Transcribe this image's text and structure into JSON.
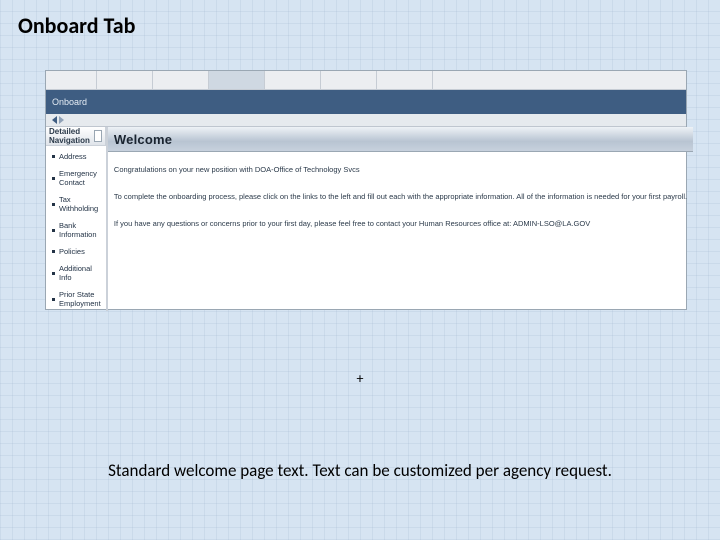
{
  "slide": {
    "title": "Onboard Tab",
    "plus": "+",
    "caption": "Standard welcome page text. Text can be customized per agency request."
  },
  "app": {
    "section": "Onboard"
  },
  "sidebar": {
    "header": "Detailed Navigation",
    "items": [
      "Address",
      "Emergency Contact",
      "Tax Withholding",
      "Bank Information",
      "Policies",
      "Additional Info",
      "Prior State Employment"
    ]
  },
  "main": {
    "heading": "Welcome",
    "lines": [
      "Congratulations on your new position with DOA-Office of Technology Svcs",
      "To complete the onboarding process, please click on the links to the left and fill out each with the appropriate information. All of the information is needed for your first payroll.",
      "If you have any questions or concerns prior to your first day, please feel free to contact your Human Resources office at: ADMIN-LSO@LA.GOV"
    ]
  }
}
